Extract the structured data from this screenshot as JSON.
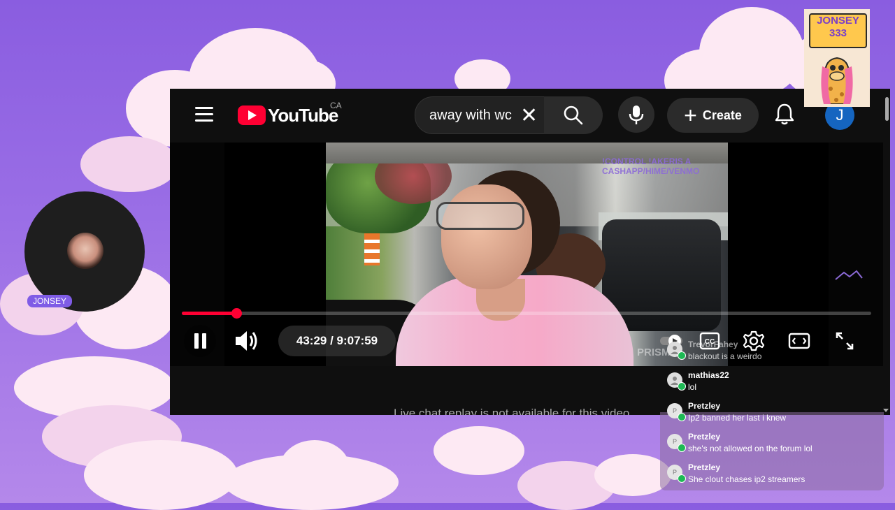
{
  "youtube": {
    "logo_text": "YouTube",
    "country_code": "CA",
    "search_value": "away with wc",
    "create_label": "Create",
    "avatar_initial": "J",
    "time_display": "43:29 / 9:07:59",
    "progress_fraction": 0.079,
    "chat_replay_text": "Live chat replay is not available for this video.",
    "video_overlay_line1": "!CONTROL !AKERIS A",
    "video_overlay_line2": "CASHAPP/HIME/VENMO",
    "watermark": "PRISM"
  },
  "chat": {
    "messages": [
      {
        "user": "TrevorFahey",
        "text": "blackout is a weirdo",
        "avatar": "icon"
      },
      {
        "user": "mathias22",
        "text": "lol",
        "avatar": "icon"
      },
      {
        "user": "Pretzley",
        "text": "Ip2 banned her last i knew",
        "avatar": "P"
      },
      {
        "user": "Pretzley",
        "text": "she's not allowed on the forum lol",
        "avatar": "P"
      },
      {
        "user": "Pretzley",
        "text": "She clout chases ip2 streamers",
        "avatar": "P"
      }
    ]
  },
  "camera": {
    "label": "JONSEY"
  },
  "sticker": {
    "line1": "JONSEY",
    "line2": "333"
  },
  "colors": {
    "background_purple": "#8a5de0",
    "youtube_red": "#ff0033",
    "label_purple": "#7f5ce6"
  }
}
